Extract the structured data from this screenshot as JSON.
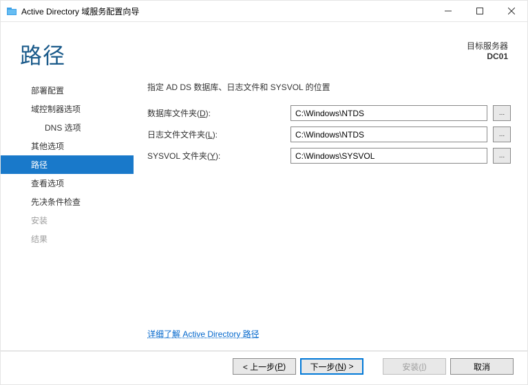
{
  "window": {
    "title": "Active Directory 域服务配置向导"
  },
  "header": {
    "heading": "路径",
    "target_label": "目标服务器",
    "target_name": "DC01"
  },
  "sidebar": {
    "items": [
      {
        "label": "部署配置"
      },
      {
        "label": "域控制器选项"
      },
      {
        "label": "DNS 选项",
        "sub": true
      },
      {
        "label": "其他选项"
      },
      {
        "label": "路径",
        "selected": true
      },
      {
        "label": "查看选项"
      },
      {
        "label": "先决条件检查"
      },
      {
        "label": "安装",
        "disabled": true
      },
      {
        "label": "结果",
        "disabled": true
      }
    ]
  },
  "main": {
    "instruction": "指定 AD DS 数据库、日志文件和 SYSVOL 的位置",
    "rows": [
      {
        "label_pre": "数据库文件夹(",
        "hotkey": "D",
        "label_post": "):",
        "value": "C:\\Windows\\NTDS"
      },
      {
        "label_pre": "日志文件文件夹(",
        "hotkey": "L",
        "label_post": "):",
        "value": "C:\\Windows\\NTDS"
      },
      {
        "label_pre": "SYSVOL 文件夹(",
        "hotkey": "Y",
        "label_post": "):",
        "value": "C:\\Windows\\SYSVOL"
      }
    ],
    "browse_label": "...",
    "more_link": "详细了解 Active Directory 路径"
  },
  "footer": {
    "prev_pre": "< 上一步(",
    "prev_hk": "P",
    "prev_post": ")",
    "next_pre": "下一步(",
    "next_hk": "N",
    "next_post": ") >",
    "install_pre": "安装(",
    "install_hk": "I",
    "install_post": ")",
    "cancel": "取消"
  }
}
